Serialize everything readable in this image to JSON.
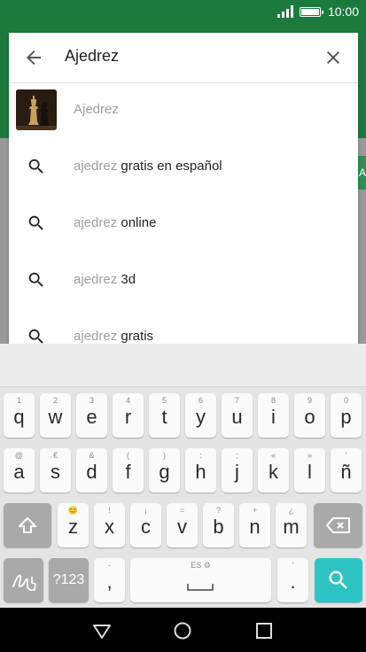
{
  "status_bar": {
    "time": "10:00"
  },
  "search": {
    "query": "Ajedrez"
  },
  "side_chip": "A",
  "suggestions": [
    {
      "type": "app",
      "prefix": "Ajedrez",
      "suffix": ""
    },
    {
      "type": "query",
      "prefix": "ajedrez",
      "suffix": " gratis en español"
    },
    {
      "type": "query",
      "prefix": "ajedrez",
      "suffix": " online"
    },
    {
      "type": "query",
      "prefix": "ajedrez",
      "suffix": " 3d"
    },
    {
      "type": "query",
      "prefix": "ajedrez",
      "suffix": " gratis"
    }
  ],
  "keyboard": {
    "row1": [
      {
        "k": "q",
        "a": "1"
      },
      {
        "k": "w",
        "a": "2"
      },
      {
        "k": "e",
        "a": "3"
      },
      {
        "k": "r",
        "a": "4"
      },
      {
        "k": "t",
        "a": "5"
      },
      {
        "k": "y",
        "a": "6"
      },
      {
        "k": "u",
        "a": "7"
      },
      {
        "k": "i",
        "a": "8"
      },
      {
        "k": "o",
        "a": "9"
      },
      {
        "k": "p",
        "a": "0"
      }
    ],
    "row2": [
      {
        "k": "a",
        "a": "@"
      },
      {
        "k": "s",
        "a": "€"
      },
      {
        "k": "d",
        "a": "&"
      },
      {
        "k": "f",
        "a": "("
      },
      {
        "k": "g",
        "a": ")"
      },
      {
        "k": "h",
        "a": ":"
      },
      {
        "k": "j",
        "a": ";"
      },
      {
        "k": "k",
        "a": "«"
      },
      {
        "k": "l",
        "a": "»"
      },
      {
        "k": "ñ",
        "a": "'"
      }
    ],
    "row3": [
      {
        "k": "z",
        "a": "😊"
      },
      {
        "k": "x",
        "a": "!"
      },
      {
        "k": "c",
        "a": "¡"
      },
      {
        "k": "v",
        "a": "="
      },
      {
        "k": "b",
        "a": "?"
      },
      {
        "k": "n",
        "a": "+"
      },
      {
        "k": "m",
        "a": "¿"
      }
    ],
    "symbols_label": "?123",
    "comma": ",",
    "comma_alt": "-",
    "period": ".",
    "period_alt": "'",
    "space_label": "ES ⚙"
  }
}
